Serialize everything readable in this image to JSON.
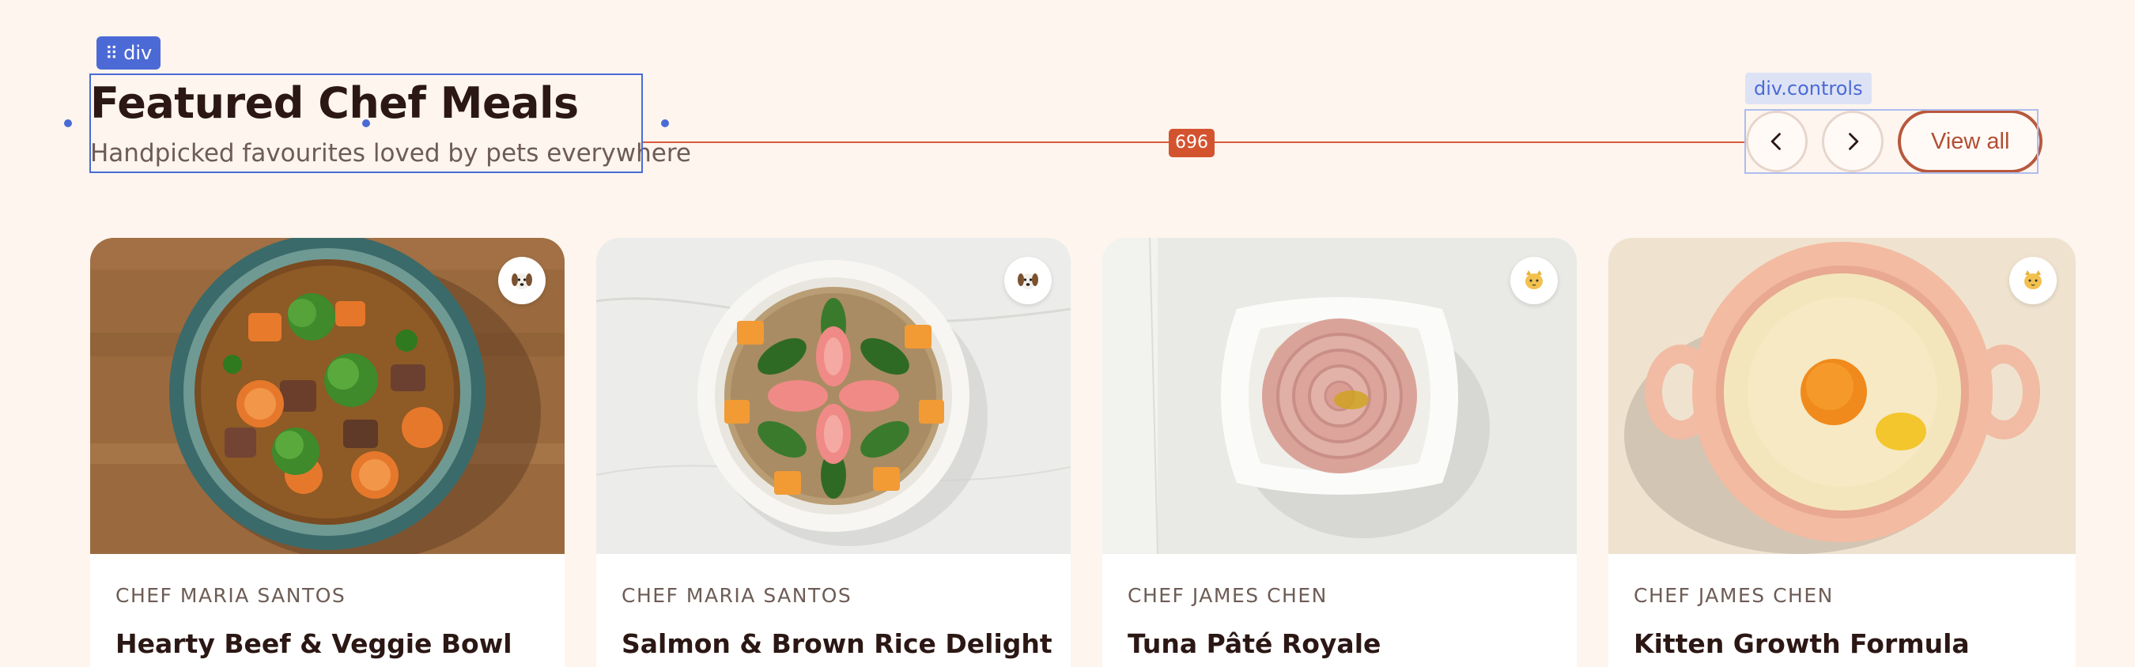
{
  "section": {
    "title": "Featured Chef Meals",
    "subtitle": "Handpicked favourites loved by pets everywhere"
  },
  "editor": {
    "selection_tag": "div",
    "controls_tag": "div.controls",
    "distance_label": "696"
  },
  "controls": {
    "prev_icon": "chevron-left-icon",
    "next_icon": "chevron-right-icon",
    "view_all_label": "View all"
  },
  "colors": {
    "background": "#fdf5ee",
    "accent": "#b8583d",
    "selection": "#4a6bd6",
    "measure": "#d4532f"
  },
  "meals": [
    {
      "chef": "CHEF MARIA SANTOS",
      "name": "Hearty Beef & Veggie Bowl",
      "pet_icon": "dog-icon"
    },
    {
      "chef": "CHEF MARIA SANTOS",
      "name": "Salmon & Brown Rice Delight",
      "pet_icon": "dog-icon"
    },
    {
      "chef": "CHEF JAMES CHEN",
      "name": "Tuna Pâté Royale",
      "pet_icon": "cat-icon"
    },
    {
      "chef": "CHEF JAMES CHEN",
      "name": "Kitten Growth Formula",
      "pet_icon": "cat-icon"
    }
  ]
}
